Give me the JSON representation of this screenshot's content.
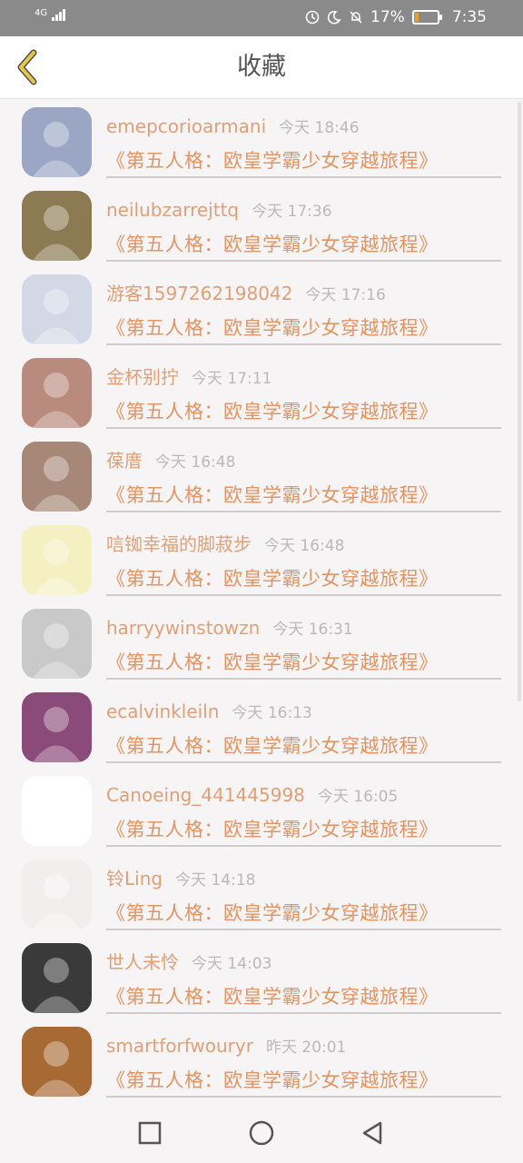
{
  "status_bar": {
    "network": "4G",
    "battery": "17%",
    "battery_level": 0.17,
    "time": "7:35"
  },
  "header": {
    "title": "收藏"
  },
  "items": [
    {
      "username": "emepcorioarmani",
      "time": "今天 18:46",
      "book": "《第五人格：欧皇学霸少女穿越旅程》",
      "avatar_color": "#9aa6c4"
    },
    {
      "username": "neilubzarrejttq",
      "time": "今天 17:36",
      "book": "《第五人格：欧皇学霸少女穿越旅程》",
      "avatar_color": "#8b7a52"
    },
    {
      "username": "游客1597262198042",
      "time": "今天 17:16",
      "book": "《第五人格：欧皇学霸少女穿越旅程》",
      "avatar_color": "#d3d8e6"
    },
    {
      "username": "金杯别拧",
      "time": "今天 17:11",
      "book": "《第五人格：欧皇学霸少女穿越旅程》",
      "avatar_color": "#b98a7e"
    },
    {
      "username": "葆庴",
      "time": "今天 16:48",
      "book": "《第五人格：欧皇学霸少女穿越旅程》",
      "avatar_color": "#a78878"
    },
    {
      "username": "唁铷幸福的脚菽步",
      "time": "今天 16:48",
      "book": "《第五人格：欧皇学霸少女穿越旅程》",
      "avatar_color": "#f5f0c2"
    },
    {
      "username": "harryywinstowzn",
      "time": "今天 16:31",
      "book": "《第五人格：欧皇学霸少女穿越旅程》",
      "avatar_color": "#c9c9c9"
    },
    {
      "username": "ecalvinkleiln",
      "time": "今天 16:13",
      "book": "《第五人格：欧皇学霸少女穿越旅程》",
      "avatar_color": "#8a4a7a"
    },
    {
      "username": "Canoeing_441445998",
      "time": "今天 16:05",
      "book": "《第五人格：欧皇学霸少女穿越旅程》",
      "avatar_color": "#ffffff"
    },
    {
      "username": "铃Ling",
      "time": "今天 14:18",
      "book": "《第五人格：欧皇学霸少女穿越旅程》",
      "avatar_color": "#f2eeee"
    },
    {
      "username": "世人未怜",
      "time": "今天 14:03",
      "book": "《第五人格：欧皇学霸少女穿越旅程》",
      "avatar_color": "#3a3a3a"
    },
    {
      "username": "smartforfwouryr",
      "time": "昨天 20:01",
      "book": "《第五人格：欧皇学霸少女穿越旅程》",
      "avatar_color": "#a86a34"
    }
  ],
  "colors": {
    "username": "#e0a077",
    "book_title": "#e39463",
    "timestamp": "#b9b9b9",
    "back_icon": "#e6c64a"
  }
}
